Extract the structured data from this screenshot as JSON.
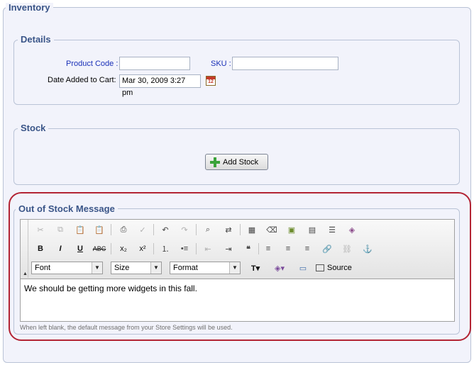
{
  "inventory": {
    "legend": "Inventory",
    "details": {
      "legend": "Details",
      "product_code_label": "Product Code :",
      "product_code_value": "",
      "sku_label": "SKU :",
      "sku_value": "",
      "date_label": "Date Added to Cart:",
      "date_value": "Mar 30, 2009 3:27 pm"
    },
    "stock": {
      "legend": "Stock",
      "add_stock_label": "Add Stock"
    },
    "out_of_stock": {
      "legend": "Out of Stock Message",
      "font_select": "Font",
      "size_select": "Size",
      "format_select": "Format",
      "source_label": "Source",
      "message": "We should be getting more widgets in this fall.",
      "hint": "When left blank, the default message from your Store Settings will be used."
    }
  },
  "colors": {
    "accent": "#3a5588",
    "highlight_border": "#b32434",
    "label_blue": "#1a30b8"
  }
}
